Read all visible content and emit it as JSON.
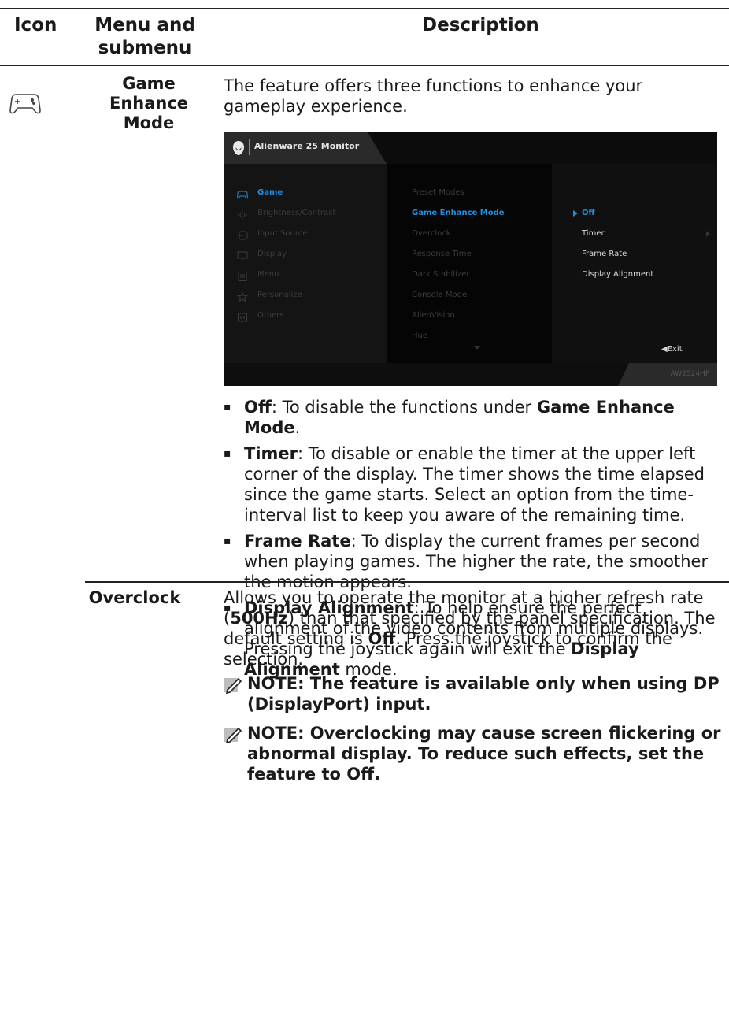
{
  "table": {
    "headers": {
      "icon": "Icon",
      "menu": "Menu and submenu",
      "description": "Description"
    }
  },
  "game_enhance": {
    "menu_label": "Game Enhance Mode",
    "intro": "The feature offers three functions to enhance your gameplay experience.",
    "bullets": [
      {
        "term": "Off",
        "text_before": ": To disable the functions under ",
        "bold_tail": "Game Enhance Mode",
        "text_after": "."
      },
      {
        "term": "Timer",
        "text": ": To disable or enable the timer at the upper left corner of the display. The timer shows the time elapsed since the game starts. Select an option from the time-interval list to keep you aware of the remaining time."
      },
      {
        "term": "Frame Rate",
        "text": ": To display the current frames per second when playing games. The higher the rate, the smoother the motion appears."
      },
      {
        "term": "Display Alignment",
        "text_before": ": To help ensure the perfect alignment of the video contents from multiple displays. Pressing the joystick again will exit the ",
        "bold_tail": "Display Alignment",
        "text_after": " mode."
      }
    ]
  },
  "osd": {
    "title": "Alienware 25 Monitor",
    "model": "AW2524HF",
    "exit_label": "◀Exit",
    "left_menu": [
      {
        "label": "Game",
        "icon": "gamepad-icon",
        "active": true
      },
      {
        "label": "Brightness/Contrast",
        "icon": "brightness-icon",
        "active": false
      },
      {
        "label": "Input Source",
        "icon": "input-source-icon",
        "active": false
      },
      {
        "label": "Display",
        "icon": "display-icon",
        "active": false
      },
      {
        "label": "Menu",
        "icon": "menu-icon",
        "active": false
      },
      {
        "label": "Personalize",
        "icon": "star-icon",
        "active": false
      },
      {
        "label": "Others",
        "icon": "others-icon",
        "active": false
      }
    ],
    "mid_menu": [
      {
        "label": "Preset Modes",
        "active": false
      },
      {
        "label": "Game Enhance Mode",
        "active": true
      },
      {
        "label": "Overclock",
        "active": false
      },
      {
        "label": "Response Time",
        "active": false
      },
      {
        "label": "Dark Stabilizer",
        "active": false
      },
      {
        "label": "Console Mode",
        "active": false
      },
      {
        "label": "AlienVision",
        "active": false
      },
      {
        "label": "Hue",
        "active": false
      }
    ],
    "right_menu": [
      {
        "label": "Off",
        "selected": true
      },
      {
        "label": "Timer",
        "selected": false
      },
      {
        "label": "Frame Rate",
        "selected": false
      },
      {
        "label": "Display Alignment",
        "selected": false
      }
    ],
    "colors": {
      "accent": "#1f8fe0",
      "background": "#000000"
    }
  },
  "overclock": {
    "menu_label": "Overclock",
    "desc_1": "Allows you to operate the monitor at a higher refresh rate (",
    "desc_bold_1": "500Hz",
    "desc_2": ") than that specified by the panel specification. The default setting is ",
    "desc_bold_2": "Off",
    "desc_3": ". Press the joystick to confirm the selection.",
    "notes": [
      "NOTE: The feature is available only when using DP (DisplayPort) input.",
      "NOTE: Overclocking may cause screen flickering or abnormal display. To reduce such effects, set the feature to Off."
    ]
  }
}
